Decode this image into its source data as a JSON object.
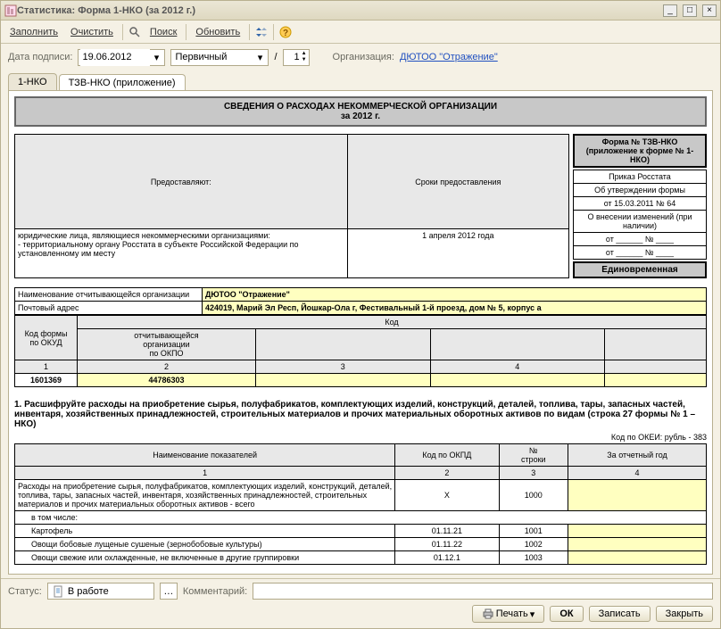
{
  "window": {
    "title": "Статистика: Форма 1-НКО (за 2012 г.)"
  },
  "toolbar": {
    "fill": "Заполнить",
    "clear": "Очистить",
    "search": "Поиск",
    "refresh": "Обновить"
  },
  "params": {
    "date_label": "Дата подписи:",
    "date_value": "19.06.2012",
    "type": "Первичный",
    "slash": "/",
    "page": "1",
    "org_label": "Организация:",
    "org_value": "ДЮТОО \"Отражение\""
  },
  "tabs": {
    "t1": "1-НКО",
    "t2": "ТЗВ-НКО (приложение)"
  },
  "doc": {
    "title1": "СВЕДЕНИЯ О РАСХОДАХ НЕКОММЕРЧЕСКОЙ ОРГАНИЗАЦИИ",
    "title2": "за 2012 г.",
    "provide_hdr": "Предоставляют:",
    "deadline_hdr": "Сроки предоставления",
    "provide_text": "юридические лица, являющиеся некоммерческими организациями:\n- территориальному органу Росстата в субъекте Российской Федерации по установленному им месту",
    "deadline_text": "1 апреля 2012 года",
    "form_no": "Форма № ТЗВ-НКО\n(приложение к форме № 1-НКО)",
    "order1": "Приказ Росстата",
    "order2": "Об утверждении формы",
    "order3": "от 15.03.2011 № 64",
    "order4": "О внесении изменений (при наличии)",
    "order5": "от ______ № ____",
    "order6": "от ______ № ____",
    "onetime": "Единовременная",
    "org_name_lbl": "Наименование отчитывающейся организации",
    "org_name_val": "ДЮТОО \"Отражение\"",
    "addr_lbl": "Почтовый адрес",
    "addr_val": "424019, Марий Эл Респ, Йошкар-Ола г, Фестивальный 1-й проезд, дом № 5, корпус а",
    "code_hdr": "Код",
    "okud_lbl": "Код формы\nпо ОКУД",
    "okpo_lbl": "отчитывающейся\nорганизации\nпо ОКПО",
    "col1": "1",
    "col2": "2",
    "col3": "3",
    "col4": "4",
    "okud_val": "1601369",
    "okpo_val": "44786303",
    "sec1": "1. Расшифруйте расходы на приобретение сырья, полуфабрикатов, комплектующих изделий, конструкций, деталей, топлива, тары, запасных частей, инвентаря, хозяйственных принадлежностей, строительных материалов и прочих материальных оборотных активов по видам (строка 27 формы № 1 – НКО)",
    "okei": "Код по ОКЕИ: рубль - 383",
    "th_name": "Наименование показателей",
    "th_okpd": "Код по ОКПД",
    "th_line": "№\nстроки",
    "th_year": "За отчетный год",
    "r1_name": "Расходы на приобретение сырья, полуфабрикатов, комплектующих изделий, конструкций, деталей, топлива, тары, запасных частей, инвентаря, хозяйственных принадлежностей, строительных материалов и прочих материальных оборотных активов - всего",
    "r1_okpd": "Х",
    "r1_line": "1000",
    "r2_name": "в том числе:",
    "r3_name": "Картофель",
    "r3_okpd": "01.11.21",
    "r3_line": "1001",
    "r4_name": "Овощи бобовые лущеные сушеные (зернобобовые культуры)",
    "r4_okpd": "01.11.22",
    "r4_line": "1002",
    "r5_name": "Овощи свежие или охлажденные, не включенные в другие группировки",
    "r5_okpd": "01.12.1",
    "r5_line": "1003"
  },
  "footer": {
    "status_lbl": "Статус:",
    "status_val": "В работе",
    "comment_lbl": "Комментарий:",
    "print": "Печать",
    "ok": "ОК",
    "save": "Записать",
    "close": "Закрыть"
  }
}
